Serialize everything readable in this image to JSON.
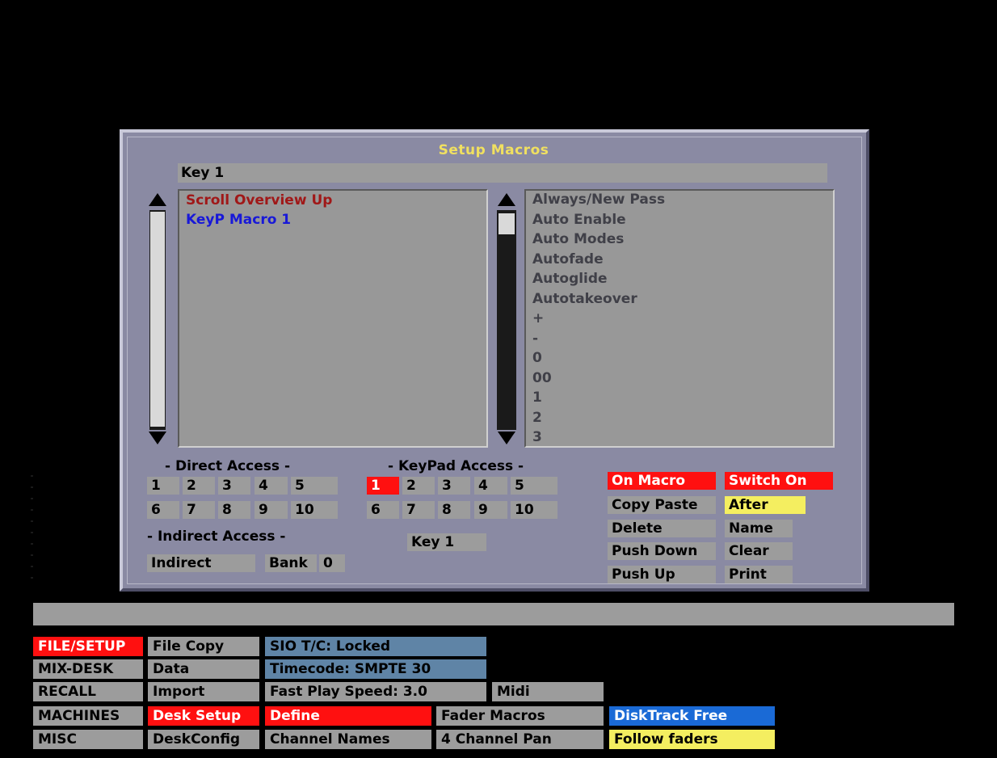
{
  "dialog": {
    "title": "Setup Macros",
    "key_field": "Key 1",
    "macro_list": [
      {
        "label": "Scroll Overview Up",
        "color": "#a01818"
      },
      {
        "label": "KeyP Macro 1",
        "color": "#1818d8"
      }
    ],
    "command_list": [
      "Always/New Pass",
      "Auto Enable",
      "Auto Modes",
      "Autofade",
      "Autoglide",
      "Autotakeover",
      "+",
      "-",
      "0",
      "00",
      "1",
      "2",
      "3"
    ],
    "direct_access": {
      "label": "- Direct Access -",
      "keys": [
        "1",
        "2",
        "3",
        "4",
        "5",
        "6",
        "7",
        "8",
        "9",
        "10"
      ]
    },
    "keypad_access": {
      "label": "- KeyPad Access -",
      "keys": [
        "1",
        "2",
        "3",
        "4",
        "5",
        "6",
        "7",
        "8",
        "9",
        "10"
      ],
      "selected": "1",
      "key_field": "Key 1"
    },
    "indirect_access": {
      "label": "- Indirect Access -",
      "indirect_button": "Indirect",
      "bank_label": "Bank",
      "bank_value": "0"
    },
    "buttons": {
      "on_macro": "On Macro",
      "switch_on": "Switch On",
      "copy_paste": "Copy Paste",
      "after": "After",
      "delete": "Delete",
      "name": "Name",
      "push_down": "Push Down",
      "clear": "Clear",
      "push_up": "Push Up",
      "print": "Print"
    }
  },
  "bottom_menu": {
    "col1": [
      "FILE/SETUP",
      "MIX-DESK",
      "RECALL",
      "MACHINES",
      "MISC"
    ],
    "col2": [
      "File Copy",
      "Data",
      "Import",
      "Desk Setup",
      "DeskConfig"
    ],
    "status": [
      "SIO T/C: Locked",
      "Timecode: SMPTE 30",
      "Fast Play Speed: 3.0"
    ],
    "midi": "Midi",
    "define": "Define",
    "channel_names": "Channel Names",
    "fader_macros": "Fader Macros",
    "four_channel_pan": "4 Channel Pan",
    "disktrack_free": "DiskTrack Free",
    "follow_faders": "Follow faders"
  },
  "colors": {
    "accent_red": "#ff1010",
    "accent_yellow": "#f4ee60",
    "title_yellow": "#f0e060",
    "slate_blue": "#5f84a6",
    "bright_blue": "#1a6ad6",
    "panel": "#8a8aa3",
    "field": "#9c9c9c"
  }
}
